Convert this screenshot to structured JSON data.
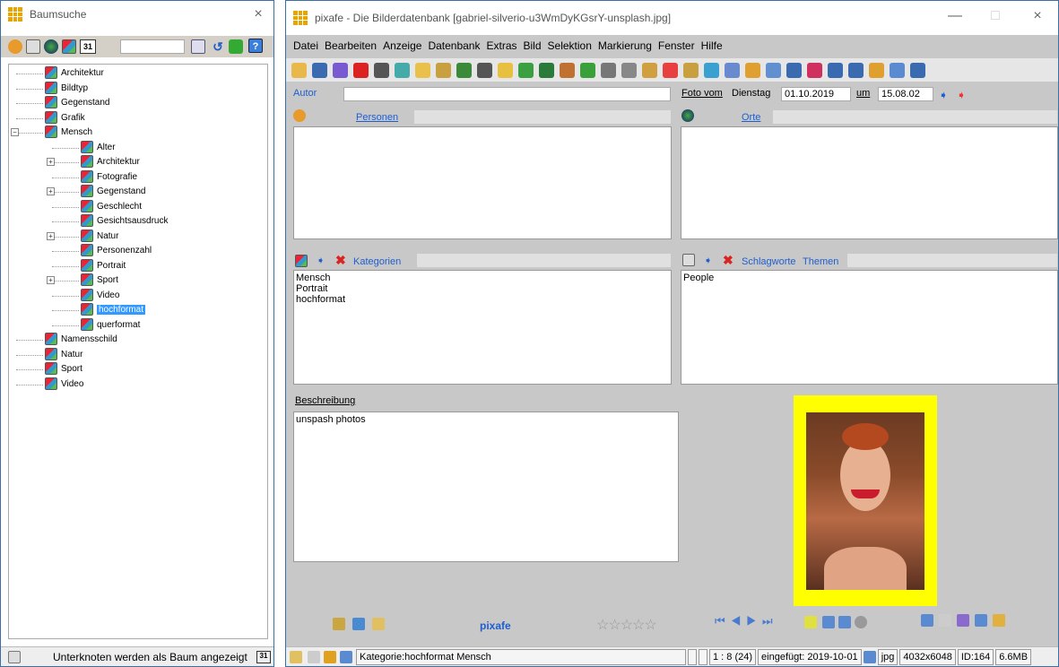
{
  "left_panel": {
    "title": "Baumsuche",
    "close": "×",
    "calendar_label": "31",
    "tree": [
      {
        "label": "Architektur",
        "depth": 0
      },
      {
        "label": "Bildtyp",
        "depth": 0
      },
      {
        "label": "Gegenstand",
        "depth": 0
      },
      {
        "label": "Grafik",
        "depth": 0
      },
      {
        "label": "Mensch",
        "depth": 0,
        "expanded": true
      },
      {
        "label": "Alter",
        "depth": 1
      },
      {
        "label": "Architektur",
        "depth": 1,
        "collapsed": true
      },
      {
        "label": "Fotografie",
        "depth": 1
      },
      {
        "label": "Gegenstand",
        "depth": 1,
        "collapsed": true
      },
      {
        "label": "Geschlecht",
        "depth": 1
      },
      {
        "label": "Gesichtsausdruck",
        "depth": 1
      },
      {
        "label": "Natur",
        "depth": 1,
        "collapsed": true
      },
      {
        "label": "Personenzahl",
        "depth": 1
      },
      {
        "label": "Portrait",
        "depth": 1
      },
      {
        "label": "Sport",
        "depth": 1,
        "collapsed": true
      },
      {
        "label": "Video",
        "depth": 1
      },
      {
        "label": "hochformat",
        "depth": 1,
        "selected": true
      },
      {
        "label": "querformat",
        "depth": 1
      },
      {
        "label": "Namensschild",
        "depth": 0
      },
      {
        "label": "Natur",
        "depth": 0
      },
      {
        "label": "Sport",
        "depth": 0
      },
      {
        "label": "Video",
        "depth": 0
      }
    ],
    "status": "Unterknoten werden als Baum angezeigt",
    "status_cal": "31"
  },
  "main": {
    "title": "pixafe - Die Bilderdatenbank  [gabriel-silverio-u3WmDyKGsrY-unsplash.jpg]",
    "window_controls": {
      "min": "—",
      "max": "□",
      "close": "×"
    },
    "menu": [
      "Datei",
      "Bearbeiten",
      "Anzeige",
      "Datenbank",
      "Extras",
      "Bild",
      "Selektion",
      "Markierung",
      "Fenster",
      "Hilfe"
    ],
    "autor_label": "Autor",
    "autor_value": "",
    "foto_vom_label": "Foto vom",
    "weekday": "Dienstag",
    "date": "01.10.2019",
    "um_label": "um",
    "time": "15.08.02",
    "personen_label": "Personen",
    "orte_label": "Orte",
    "kategorien_label": "Kategorien",
    "kategorien": [
      "Mensch",
      "Portrait",
      "hochformat"
    ],
    "schlagworte_label": "Schlagworte",
    "themen_label": "Themen",
    "schlagworte": [
      "People"
    ],
    "beschreibung_label": "Beschreibung",
    "beschreibung": "unspash photos",
    "brand": "pixafe",
    "rating": "☆☆☆☆☆",
    "status": {
      "category": "Kategorie:hochformat Mensch",
      "position": "1 : 8 (24)",
      "inserted": "eingefügt: 2019-10-01",
      "type": "jpg",
      "resolution": "4032x6048",
      "id": "ID:164",
      "size": "6.6MB"
    },
    "colors": {
      "frame": "#ffff00",
      "accent": "#1e5fd0"
    }
  }
}
